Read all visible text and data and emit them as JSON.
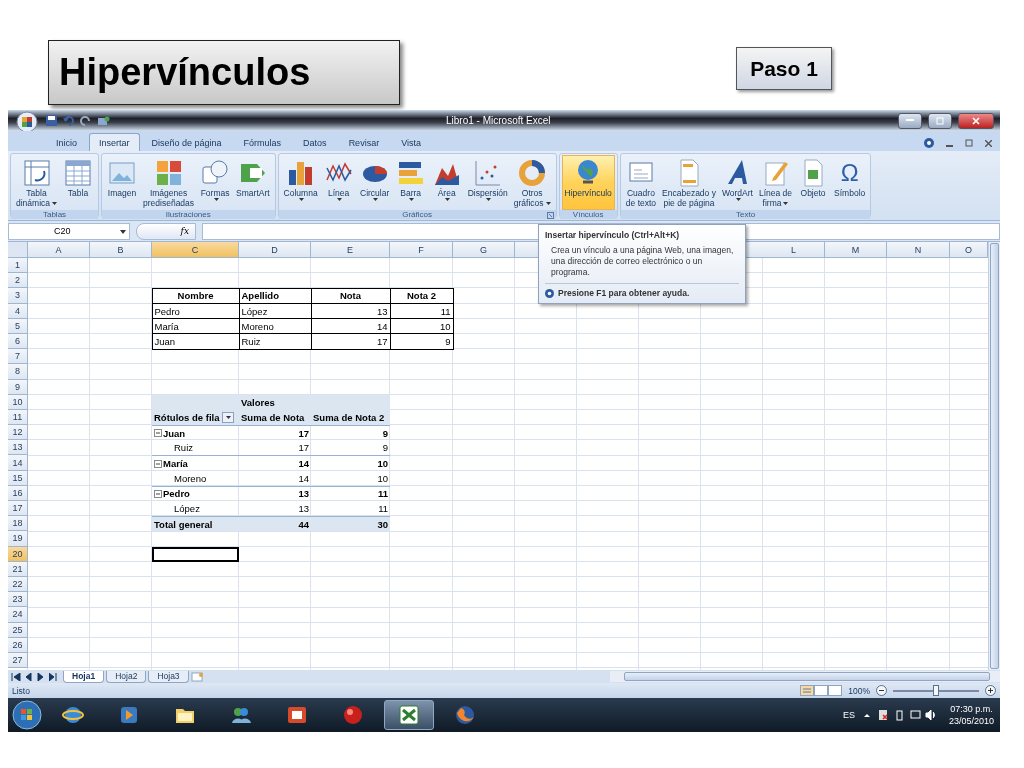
{
  "slide": {
    "title": "Hipervínculos",
    "step": "Paso 1"
  },
  "excel": {
    "title": "Libro1 - Microsoft Excel",
    "tabs": [
      {
        "label": "Inicio",
        "selected": false
      },
      {
        "label": "Insertar",
        "selected": true
      },
      {
        "label": "Diseño de página",
        "selected": false
      },
      {
        "label": "Fórmulas",
        "selected": false
      },
      {
        "label": "Datos",
        "selected": false
      },
      {
        "label": "Revisar",
        "selected": false
      },
      {
        "label": "Vista",
        "selected": false
      }
    ],
    "ribbon": [
      {
        "name": "Tablas",
        "launcher": false,
        "buttons": [
          {
            "lines": [
              "Tabla",
              "dinámica"
            ],
            "dropdown": true,
            "hovered": false
          },
          {
            "lines": [
              "Tabla"
            ],
            "dropdown": false,
            "hovered": false
          }
        ]
      },
      {
        "name": "Ilustraciones",
        "launcher": false,
        "buttons": [
          {
            "lines": [
              "Imagen"
            ],
            "dropdown": false,
            "hovered": false
          },
          {
            "lines": [
              "Imágenes",
              "prediseñadas"
            ],
            "dropdown": false,
            "hovered": false
          },
          {
            "lines": [
              "Formas"
            ],
            "dropdown": true,
            "hovered": false
          },
          {
            "lines": [
              "SmartArt"
            ],
            "dropdown": false,
            "hovered": false
          }
        ]
      },
      {
        "name": "Gráficos",
        "launcher": true,
        "buttons": [
          {
            "lines": [
              "Columna"
            ],
            "dropdown": true,
            "hovered": false
          },
          {
            "lines": [
              "Línea"
            ],
            "dropdown": true,
            "hovered": false
          },
          {
            "lines": [
              "Circular"
            ],
            "dropdown": true,
            "hovered": false
          },
          {
            "lines": [
              "Barra"
            ],
            "dropdown": true,
            "hovered": false
          },
          {
            "lines": [
              "Área"
            ],
            "dropdown": true,
            "hovered": false
          },
          {
            "lines": [
              "Dispersión"
            ],
            "dropdown": true,
            "hovered": false
          },
          {
            "lines": [
              "Otros",
              "gráficos"
            ],
            "dropdown": true,
            "hovered": false
          }
        ]
      },
      {
        "name": "Vínculos",
        "launcher": false,
        "buttons": [
          {
            "lines": [
              "Hipervínculo"
            ],
            "dropdown": false,
            "hovered": true
          }
        ]
      },
      {
        "name": "Texto",
        "launcher": false,
        "buttons": [
          {
            "lines": [
              "Cuadro",
              "de texto"
            ],
            "dropdown": false,
            "hovered": false
          },
          {
            "lines": [
              "Encabezado y",
              "pie de página"
            ],
            "dropdown": false,
            "hovered": false
          },
          {
            "lines": [
              "WordArt"
            ],
            "dropdown": true,
            "hovered": false
          },
          {
            "lines": [
              "Línea de",
              "firma"
            ],
            "dropdown": true,
            "hovered": false
          },
          {
            "lines": [
              "Objeto"
            ],
            "dropdown": false,
            "hovered": false
          },
          {
            "lines": [
              "Símbolo"
            ],
            "dropdown": false,
            "hovered": false,
            "glyph": "Ω"
          }
        ]
      }
    ],
    "name_box": "C20",
    "function_label": "fx",
    "tooltip": {
      "title": "Insertar hipervínculo (Ctrl+Alt+K)",
      "body": "Crea un vínculo a una página Web, una imagen, una dirección de correo electrónico o un programa.",
      "help": "Presione F1 para obtener ayuda."
    },
    "sheet": {
      "columns": [
        {
          "label": "A",
          "selected": false
        },
        {
          "label": "B",
          "selected": false
        },
        {
          "label": "C",
          "selected": true
        },
        {
          "label": "D",
          "selected": false
        },
        {
          "label": "E",
          "selected": false
        },
        {
          "label": "F",
          "selected": false
        },
        {
          "label": "G",
          "selected": false
        },
        {
          "label": "L",
          "selected": false
        },
        {
          "label": "M",
          "selected": false
        },
        {
          "label": "N",
          "selected": false
        },
        {
          "label": "O",
          "selected": false
        }
      ],
      "rows": [
        {
          "label": "1",
          "selected": false
        },
        {
          "label": "2",
          "selected": false
        },
        {
          "label": "3",
          "selected": false
        },
        {
          "label": "4",
          "selected": false
        },
        {
          "label": "5",
          "selected": false
        },
        {
          "label": "6",
          "selected": false
        },
        {
          "label": "7",
          "selected": false
        },
        {
          "label": "8",
          "selected": false
        },
        {
          "label": "9",
          "selected": false
        },
        {
          "label": "10",
          "selected": false
        },
        {
          "label": "11",
          "selected": false
        },
        {
          "label": "12",
          "selected": false
        },
        {
          "label": "13",
          "selected": false
        },
        {
          "label": "14",
          "selected": false
        },
        {
          "label": "15",
          "selected": false
        },
        {
          "label": "16",
          "selected": false
        },
        {
          "label": "17",
          "selected": false
        },
        {
          "label": "18",
          "selected": false
        },
        {
          "label": "19",
          "selected": false
        },
        {
          "label": "20",
          "selected": true
        },
        {
          "label": "21",
          "selected": false
        },
        {
          "label": "22",
          "selected": false
        },
        {
          "label": "23",
          "selected": false
        },
        {
          "label": "24",
          "selected": false
        },
        {
          "label": "25",
          "selected": false
        },
        {
          "label": "26",
          "selected": false
        },
        {
          "label": "27",
          "selected": false
        }
      ],
      "table": {
        "headers": [
          "Nombre",
          "Apellido",
          "Nota",
          "Nota 2"
        ],
        "rows": [
          [
            "Pedro",
            "López",
            "13",
            "11"
          ],
          [
            "María",
            "Moreno",
            "14",
            "10"
          ],
          [
            "Juan",
            "Ruiz",
            "17",
            "9"
          ]
        ]
      },
      "pivot": {
        "values_header": "Valores",
        "row_labels": "Rótulos de fila",
        "columns": [
          "Suma de Nota",
          "Suma de Nota 2"
        ],
        "groups": [
          {
            "name": "Juan",
            "values": [
              "17",
              "9"
            ],
            "expanded": true,
            "children": [
              {
                "name": "Ruiz",
                "values": [
                  "17",
                  "9"
                ]
              }
            ]
          },
          {
            "name": "María",
            "values": [
              "14",
              "10"
            ],
            "expanded": true,
            "children": [
              {
                "name": "Moreno",
                "values": [
                  "14",
                  "10"
                ]
              }
            ]
          },
          {
            "name": "Pedro",
            "values": [
              "13",
              "11"
            ],
            "expanded": true,
            "children": [
              {
                "name": "López",
                "values": [
                  "13",
                  "11"
                ]
              }
            ]
          }
        ],
        "total": {
          "name": "Total general",
          "values": [
            "44",
            "30"
          ]
        }
      }
    },
    "sheet_tabs": [
      {
        "label": "Hoja1",
        "selected": true
      },
      {
        "label": "Hoja2",
        "selected": false
      },
      {
        "label": "Hoja3",
        "selected": false
      }
    ],
    "status": {
      "text": "Listo",
      "zoom": "100%",
      "level": 0.5
    }
  },
  "taskbar": {
    "apps": [
      {
        "selected": false
      },
      {
        "selected": false
      },
      {
        "selected": false
      },
      {
        "selected": false
      },
      {
        "selected": false
      },
      {
        "selected": false
      },
      {
        "selected": true
      },
      {
        "selected": false
      }
    ],
    "language": "ES",
    "time": "07:30 p.m.",
    "date": "23/05/2010"
  }
}
